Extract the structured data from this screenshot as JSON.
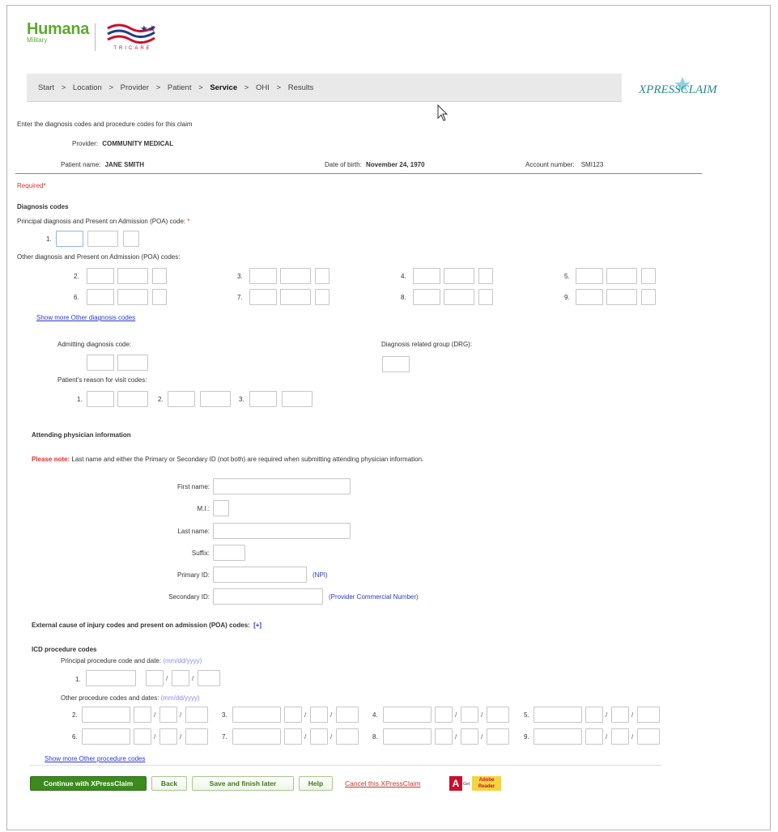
{
  "brand": {
    "name": "Humana",
    "sub": "Military",
    "tricare": "TRICARE"
  },
  "xpress_logo": "XPRESSCLAIM",
  "breadcrumb": {
    "start": "Start",
    "location": "Location",
    "provider": "Provider",
    "patient": "Patient",
    "service": "Service",
    "ohi": "OHI",
    "results": "Results",
    "sep": ">"
  },
  "intro": "Enter the diagnosis codes and procedure codes for this claim",
  "provider": {
    "label": "Provider:",
    "value": "COMMUNITY MEDICAL"
  },
  "patient": {
    "name_label": "Patient name:",
    "name": "JANE SMITH",
    "dob_label": "Date of birth:",
    "dob": "November 24, 1970",
    "account_label": "Account number:",
    "account": "SMI123"
  },
  "required": {
    "label": "Required",
    "star": "*"
  },
  "diagnosis": {
    "title": "Diagnosis codes",
    "principal_label": "Principal diagnosis and Present on Admission (POA) code:",
    "principal_num": "1.",
    "other_label": "Other diagnosis and Present on Admission (POA) codes:",
    "nums": [
      "2.",
      "3.",
      "4.",
      "5.",
      "6.",
      "7.",
      "8.",
      "9."
    ],
    "show_more": "Show more Other diagnosis codes",
    "admitting_label": "Admitting diagnosis code:",
    "drg_label": "Diagnosis related group (DRG):",
    "reason_label": "Patient's reason for visit codes:",
    "reason_nums": [
      "1.",
      "2.",
      "3."
    ]
  },
  "attending": {
    "title": "Attending physician information",
    "note_prefix": "Please note:",
    "note": "Last name and either the Primary or Secondary ID (not both) are required when submitting attending physician information.",
    "first_name": "First name:",
    "mi": "M.I.:",
    "last_name": "Last name:",
    "suffix": "Suffix:",
    "primary_id": "Primary ID:",
    "primary_hint": "(NPI)",
    "secondary_id": "Secondary ID:",
    "secondary_hint": "(Provider Commercial Number)"
  },
  "external": {
    "label": "External cause of injury codes and present on admission (POA) codes:",
    "toggle": "[+]"
  },
  "icd": {
    "title": "ICD procedure codes",
    "principal_label": "Principal procedure code and date:",
    "date_hint": "(mm/dd/yyyy)",
    "principal_num": "1.",
    "other_label": "Other procedure codes and dates:",
    "nums": [
      "2.",
      "3.",
      "4.",
      "5.",
      "6.",
      "7.",
      "8.",
      "9."
    ],
    "slash": "/",
    "show_more": "Show more Other procedure codes"
  },
  "buttons": {
    "continue": "Continue with XPressClaim",
    "back": "Back",
    "save": "Save and finish later",
    "help": "Help",
    "cancel": "Cancel this XPressClaim",
    "adobe_get": "Get",
    "adobe_name": "Adobe Reader"
  },
  "colors": {
    "humana_green": "#5fa82e",
    "required_red": "#e03030",
    "link_blue": "#2a39c9",
    "continue_bg": "#3c8a1e"
  }
}
